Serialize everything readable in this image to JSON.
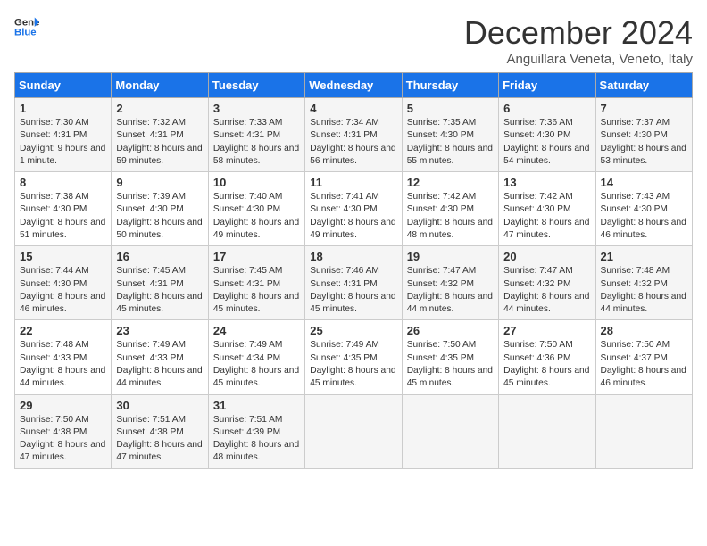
{
  "header": {
    "logo_line1": "General",
    "logo_line2": "Blue",
    "month_title": "December 2024",
    "location": "Anguillara Veneta, Veneto, Italy"
  },
  "days_of_week": [
    "Sunday",
    "Monday",
    "Tuesday",
    "Wednesday",
    "Thursday",
    "Friday",
    "Saturday"
  ],
  "weeks": [
    [
      {
        "day": "1",
        "sunrise": "7:30 AM",
        "sunset": "4:31 PM",
        "daylight": "9 hours and 1 minute."
      },
      {
        "day": "2",
        "sunrise": "7:32 AM",
        "sunset": "4:31 PM",
        "daylight": "8 hours and 59 minutes."
      },
      {
        "day": "3",
        "sunrise": "7:33 AM",
        "sunset": "4:31 PM",
        "daylight": "8 hours and 58 minutes."
      },
      {
        "day": "4",
        "sunrise": "7:34 AM",
        "sunset": "4:31 PM",
        "daylight": "8 hours and 56 minutes."
      },
      {
        "day": "5",
        "sunrise": "7:35 AM",
        "sunset": "4:30 PM",
        "daylight": "8 hours and 55 minutes."
      },
      {
        "day": "6",
        "sunrise": "7:36 AM",
        "sunset": "4:30 PM",
        "daylight": "8 hours and 54 minutes."
      },
      {
        "day": "7",
        "sunrise": "7:37 AM",
        "sunset": "4:30 PM",
        "daylight": "8 hours and 53 minutes."
      }
    ],
    [
      {
        "day": "8",
        "sunrise": "7:38 AM",
        "sunset": "4:30 PM",
        "daylight": "8 hours and 51 minutes."
      },
      {
        "day": "9",
        "sunrise": "7:39 AM",
        "sunset": "4:30 PM",
        "daylight": "8 hours and 50 minutes."
      },
      {
        "day": "10",
        "sunrise": "7:40 AM",
        "sunset": "4:30 PM",
        "daylight": "8 hours and 49 minutes."
      },
      {
        "day": "11",
        "sunrise": "7:41 AM",
        "sunset": "4:30 PM",
        "daylight": "8 hours and 49 minutes."
      },
      {
        "day": "12",
        "sunrise": "7:42 AM",
        "sunset": "4:30 PM",
        "daylight": "8 hours and 48 minutes."
      },
      {
        "day": "13",
        "sunrise": "7:42 AM",
        "sunset": "4:30 PM",
        "daylight": "8 hours and 47 minutes."
      },
      {
        "day": "14",
        "sunrise": "7:43 AM",
        "sunset": "4:30 PM",
        "daylight": "8 hours and 46 minutes."
      }
    ],
    [
      {
        "day": "15",
        "sunrise": "7:44 AM",
        "sunset": "4:30 PM",
        "daylight": "8 hours and 46 minutes."
      },
      {
        "day": "16",
        "sunrise": "7:45 AM",
        "sunset": "4:31 PM",
        "daylight": "8 hours and 45 minutes."
      },
      {
        "day": "17",
        "sunrise": "7:45 AM",
        "sunset": "4:31 PM",
        "daylight": "8 hours and 45 minutes."
      },
      {
        "day": "18",
        "sunrise": "7:46 AM",
        "sunset": "4:31 PM",
        "daylight": "8 hours and 45 minutes."
      },
      {
        "day": "19",
        "sunrise": "7:47 AM",
        "sunset": "4:32 PM",
        "daylight": "8 hours and 44 minutes."
      },
      {
        "day": "20",
        "sunrise": "7:47 AM",
        "sunset": "4:32 PM",
        "daylight": "8 hours and 44 minutes."
      },
      {
        "day": "21",
        "sunrise": "7:48 AM",
        "sunset": "4:32 PM",
        "daylight": "8 hours and 44 minutes."
      }
    ],
    [
      {
        "day": "22",
        "sunrise": "7:48 AM",
        "sunset": "4:33 PM",
        "daylight": "8 hours and 44 minutes."
      },
      {
        "day": "23",
        "sunrise": "7:49 AM",
        "sunset": "4:33 PM",
        "daylight": "8 hours and 44 minutes."
      },
      {
        "day": "24",
        "sunrise": "7:49 AM",
        "sunset": "4:34 PM",
        "daylight": "8 hours and 45 minutes."
      },
      {
        "day": "25",
        "sunrise": "7:49 AM",
        "sunset": "4:35 PM",
        "daylight": "8 hours and 45 minutes."
      },
      {
        "day": "26",
        "sunrise": "7:50 AM",
        "sunset": "4:35 PM",
        "daylight": "8 hours and 45 minutes."
      },
      {
        "day": "27",
        "sunrise": "7:50 AM",
        "sunset": "4:36 PM",
        "daylight": "8 hours and 45 minutes."
      },
      {
        "day": "28",
        "sunrise": "7:50 AM",
        "sunset": "4:37 PM",
        "daylight": "8 hours and 46 minutes."
      }
    ],
    [
      {
        "day": "29",
        "sunrise": "7:50 AM",
        "sunset": "4:38 PM",
        "daylight": "8 hours and 47 minutes."
      },
      {
        "day": "30",
        "sunrise": "7:51 AM",
        "sunset": "4:38 PM",
        "daylight": "8 hours and 47 minutes."
      },
      {
        "day": "31",
        "sunrise": "7:51 AM",
        "sunset": "4:39 PM",
        "daylight": "8 hours and 48 minutes."
      },
      null,
      null,
      null,
      null
    ]
  ],
  "labels": {
    "sunrise": "Sunrise:",
    "sunset": "Sunset:",
    "daylight": "Daylight:"
  }
}
